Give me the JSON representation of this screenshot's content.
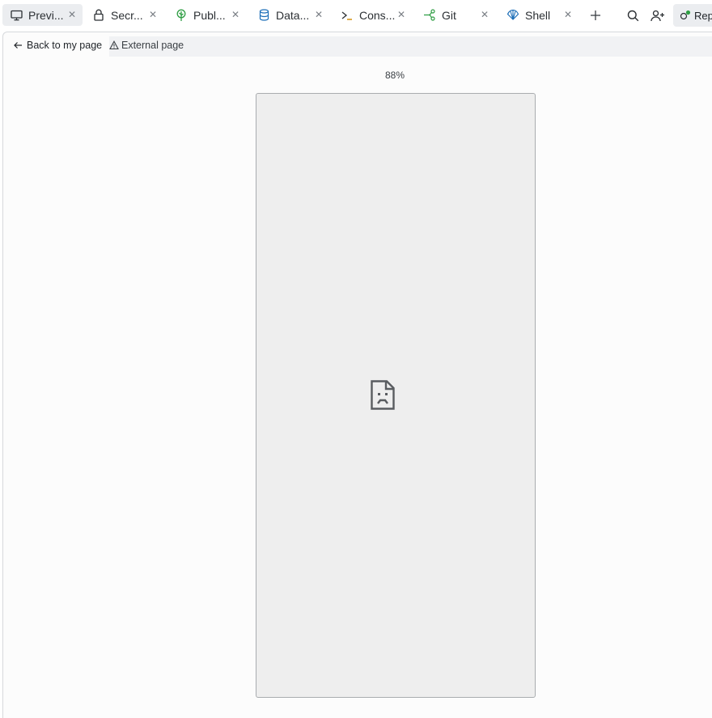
{
  "tabs": [
    {
      "label": "Previ...",
      "icon": "monitor-icon",
      "active": true
    },
    {
      "label": "Secr...",
      "icon": "lock-icon"
    },
    {
      "label": "Publ...",
      "icon": "tree-icon"
    },
    {
      "label": "Data...",
      "icon": "database-icon"
    },
    {
      "label": "Cons...",
      "icon": "terminal-icon"
    },
    {
      "label": "Git",
      "icon": "git-branch-icon"
    },
    {
      "label": "Shell",
      "icon": "shell-icon"
    }
  ],
  "toolbar": {
    "back_label": "Back to my page",
    "external_label": "External page"
  },
  "repl_button": {
    "label": "Repl"
  },
  "preview": {
    "zoom": "88%"
  },
  "colors": {
    "tab_active": "#ebedf0",
    "frame_bg": "#eeeeee",
    "accent_green": "#2f9e44",
    "shell_blue": "#1e6fb8"
  }
}
